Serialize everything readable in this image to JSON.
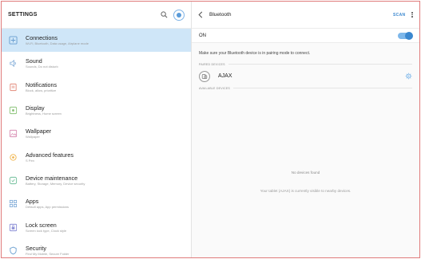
{
  "colors": {
    "accent": "#3a87cf",
    "active_row": "#cfe6f8",
    "frame_border": "#e07b7b"
  },
  "settings": {
    "title": "SETTINGS",
    "search_icon": "search-icon",
    "account_icon": "account-icon"
  },
  "menu": [
    {
      "label": "Connections",
      "sub": "Wi-Fi, Bluetooth, Data usage, Airplane mode",
      "icon": "connections-icon",
      "active": true
    },
    {
      "label": "Sound",
      "sub": "Sounds, Do not disturb",
      "icon": "sound-icon"
    },
    {
      "label": "Notifications",
      "sub": "Block, allow, prioritize",
      "icon": "notifications-icon"
    },
    {
      "label": "Display",
      "sub": "Brightness, Home screen",
      "icon": "display-icon"
    },
    {
      "label": "Wallpaper",
      "sub": "Wallpaper",
      "icon": "wallpaper-icon"
    },
    {
      "label": "Advanced features",
      "sub": "S Pen",
      "icon": "advanced-features-icon"
    },
    {
      "label": "Device maintenance",
      "sub": "Battery, Storage, Memory, Device security",
      "icon": "device-maintenance-icon"
    },
    {
      "label": "Apps",
      "sub": "Default apps, App permissions",
      "icon": "apps-icon"
    },
    {
      "label": "Lock screen",
      "sub": "Screen lock type, Clock style",
      "icon": "lock-screen-icon"
    },
    {
      "label": "Security",
      "sub": "Find My Mobile, Secure Folder",
      "icon": "security-icon"
    }
  ],
  "bluetooth": {
    "title": "Bluetooth",
    "scan_label": "SCAN",
    "on_label": "ON",
    "toggle_on": true,
    "pairing_message": "Make sure your Bluetooth device is in pairing mode to connect.",
    "paired_header": "PAIRED DEVICES",
    "paired_devices": [
      {
        "name": "AJAX",
        "icon": "device-icon",
        "settings_icon": "gear-icon"
      }
    ],
    "available_header": "AVAILABLE DEVICES",
    "empty_title": "No devices found",
    "empty_sub": "Your tablet (AJAX) is currently visible to nearby devices."
  }
}
